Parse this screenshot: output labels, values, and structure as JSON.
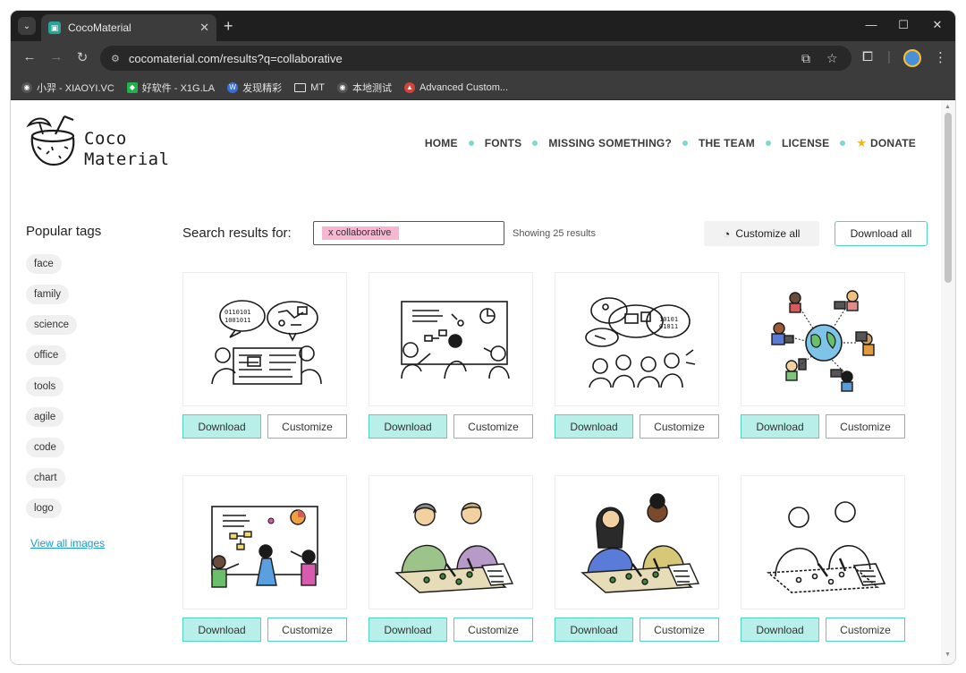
{
  "browser": {
    "tab_title": "CocoMaterial",
    "url": "cocomaterial.com/results?q=collaborative",
    "bookmarks": [
      {
        "label": "小羿 - XIAOYI.VC",
        "icon": "globe-icon",
        "color": "#555555"
      },
      {
        "label": "好软件 - X1G.LA",
        "icon": "app-icon",
        "color": "#22b14c"
      },
      {
        "label": "发现精彩",
        "icon": "wordpress-icon",
        "color": "#3a6fd8"
      },
      {
        "label": "MT",
        "icon": "folder-icon",
        "color": ""
      },
      {
        "label": "本地测试",
        "icon": "globe-icon",
        "color": "#555555"
      },
      {
        "label": "Advanced Custom...",
        "icon": "acf-icon",
        "color": "#d0453a"
      }
    ]
  },
  "site": {
    "logo_line1": "Coco",
    "logo_line2": "Material",
    "nav": [
      "HOME",
      "FONTS",
      "MISSING SOMETHING?",
      "THE TEAM",
      "LICENSE",
      "DONATE"
    ],
    "accent": "#4fd1c5",
    "accent_light": "#b8efe9"
  },
  "sidebar": {
    "title": "Popular tags",
    "tags": [
      "face",
      "family",
      "science",
      "office",
      "tools",
      "agile",
      "code",
      "chart",
      "logo"
    ],
    "view_all": "View all images"
  },
  "search": {
    "label": "Search results for:",
    "chip": "x collaborative",
    "results": "Showing 25 results",
    "customize_all": "Customize all",
    "download_all": "Download all"
  },
  "cards": [
    {
      "illustration": "two-people-speech-bubbles-data",
      "download": "Download",
      "customize": "Customize"
    },
    {
      "illustration": "team-at-whiteboard",
      "download": "Download",
      "customize": "Customize"
    },
    {
      "illustration": "group-brainstorm-bubbles",
      "download": "Download",
      "customize": "Customize"
    },
    {
      "illustration": "global-remote-team",
      "download": "Download",
      "customize": "Customize"
    },
    {
      "illustration": "colored-team-whiteboard",
      "download": "Download",
      "customize": "Customize"
    },
    {
      "illustration": "two-people-planning-colored",
      "download": "Download",
      "customize": "Customize"
    },
    {
      "illustration": "two-women-planning-colored",
      "download": "Download",
      "customize": "Customize"
    },
    {
      "illustration": "two-people-planning-outline",
      "download": "Download",
      "customize": "Customize"
    }
  ]
}
